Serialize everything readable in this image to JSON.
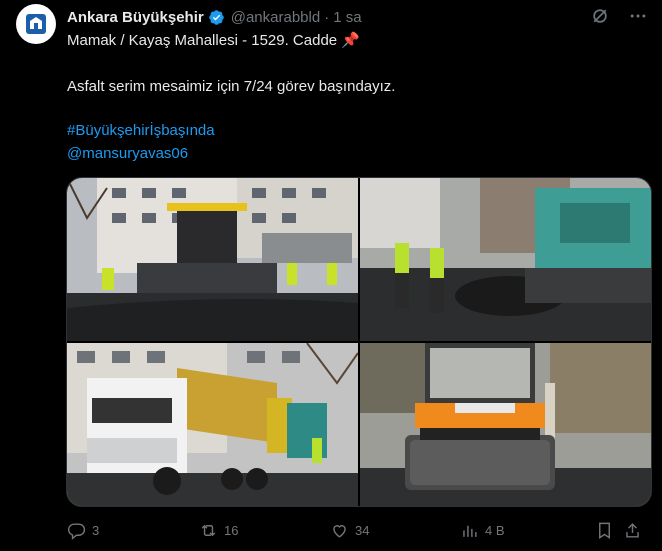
{
  "tweet": {
    "author_name": "Ankara Büyükşehir",
    "handle": "@ankarabbld",
    "separator": "·",
    "time": "1 sa",
    "line1": "Mamak / Kayaş Mahallesi - 1529. Cadde 📌",
    "line2": "Asfalt serim mesaimiz için 7/24 görev başındayız.",
    "hashtag": "#Büyükşehirİşbaşında",
    "mention": "@mansuryavas06"
  },
  "icons": {
    "verified": "verified-badge-icon",
    "grok": "grok-icon",
    "more": "more-icon",
    "reply": "reply-icon",
    "retweet": "retweet-icon",
    "like": "heart-icon",
    "views": "views-icon",
    "bookmark": "bookmark-icon",
    "share": "share-icon"
  },
  "stats": {
    "replies": "3",
    "retweets": "16",
    "likes": "34",
    "views": "4 B"
  },
  "colors": {
    "background": "#000000",
    "text": "#e7e9ea",
    "muted": "#71767b",
    "link": "#1d9bf0",
    "verified": "#1d9bf0"
  }
}
